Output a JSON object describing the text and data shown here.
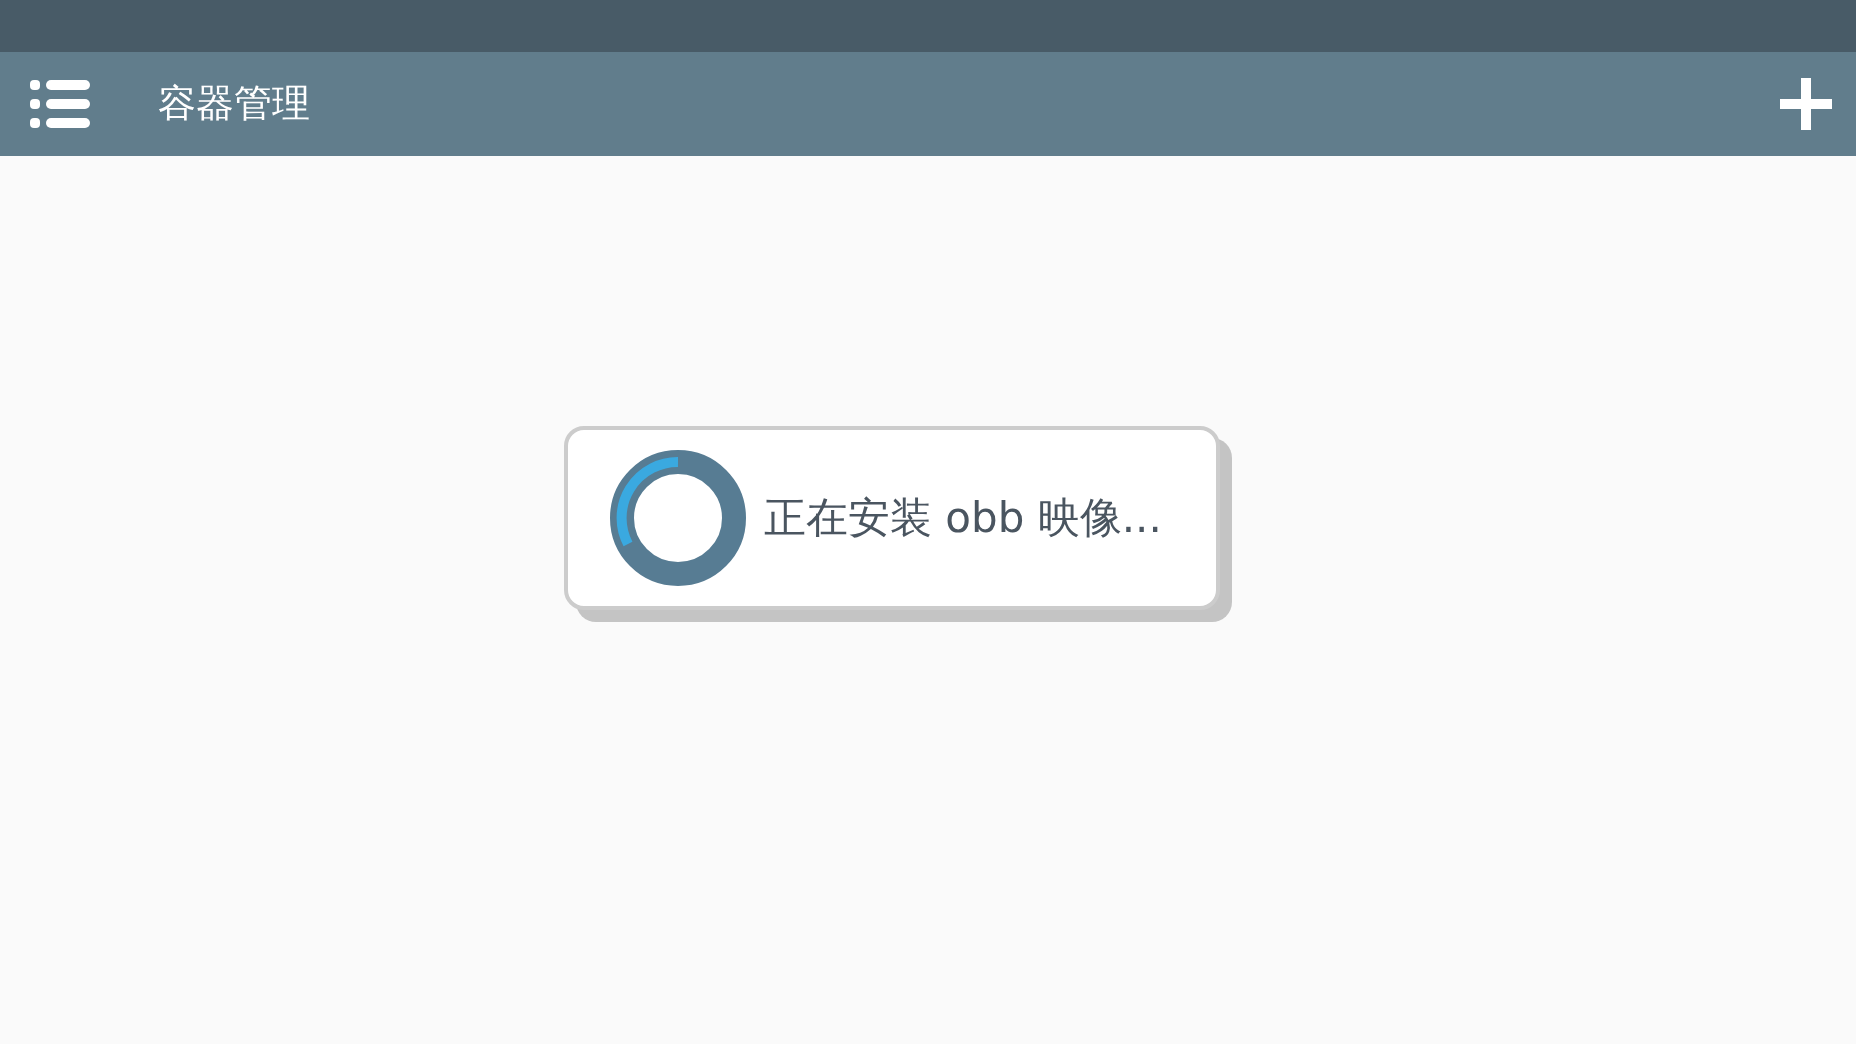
{
  "app_bar": {
    "title": "容器管理"
  },
  "dialog": {
    "message": "正在安装 obb 映像..."
  }
}
